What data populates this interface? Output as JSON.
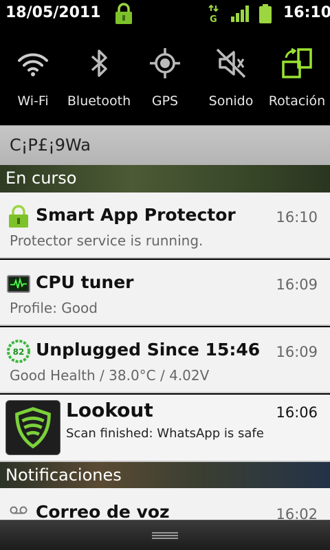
{
  "status_bar": {
    "date": "18/05/2011",
    "time": "16:10",
    "network_type": "G"
  },
  "toggles": [
    {
      "label": "Wi-Fi",
      "icon": "wifi-icon"
    },
    {
      "label": "Bluetooth",
      "icon": "bluetooth-icon"
    },
    {
      "label": "GPS",
      "icon": "gps-icon"
    },
    {
      "label": "Sonido",
      "icon": "sound-muted-icon"
    },
    {
      "label": "Rotación",
      "icon": "rotation-icon",
      "active_color": "#9be232"
    }
  ],
  "carrier": "C¡P£¡9Wa",
  "sections": {
    "ongoing": "En curso",
    "notifications": "Notificaciones"
  },
  "notifications": [
    {
      "title": "Smart App Protector",
      "time": "16:10",
      "text": "Protector service is running.",
      "icon": "lock-icon"
    },
    {
      "title": "CPU tuner",
      "time": "16:09",
      "text": "Profile: Good",
      "icon": "cpu-monitor-icon"
    },
    {
      "title": "Unplugged Since 15:46",
      "time": "16:09",
      "text": "Good Health / 38.0°C / 4.02V",
      "icon": "battery-level-icon",
      "badge": "82"
    },
    {
      "title": "Lookout",
      "time": "16:06",
      "text": "Scan finished: WhatsApp is safe",
      "icon": "lookout-shield-icon"
    },
    {
      "title": "Correo de voz",
      "time": "16:02",
      "icon": "voicemail-icon"
    }
  ],
  "colors": {
    "accent_green": "#9be232",
    "row_bg": "#f2f2f2"
  }
}
